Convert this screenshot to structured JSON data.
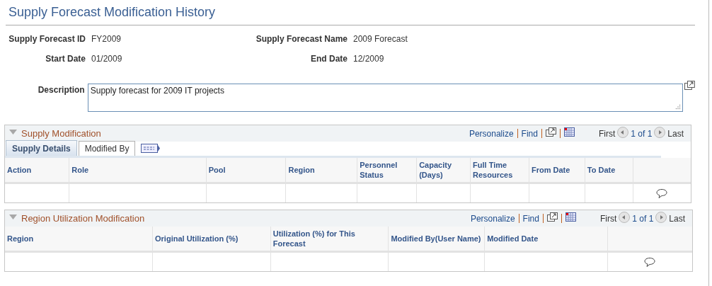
{
  "title": "Supply Forecast Modification History",
  "fields": [
    {
      "label": "Supply Forecast ID",
      "value": "FY2009"
    },
    {
      "label": "Supply Forecast Name",
      "value": "2009 Forecast"
    },
    {
      "label": "Start Date",
      "value": "01/2009"
    },
    {
      "label": "End Date",
      "value": "12/2009"
    }
  ],
  "description": {
    "label": "Description",
    "value": "Supply forecast for 2009 IT projects"
  },
  "grids": [
    {
      "title": "Supply Modification",
      "toolbar": {
        "personalize": "Personalize",
        "find": "Find",
        "first": "First",
        "range": "1 of 1",
        "last": "Last"
      },
      "tabs": [
        {
          "label": "Supply Details",
          "selected": true
        },
        {
          "label": "Modified By",
          "selected": false
        }
      ],
      "columns": [
        "Action",
        "Role",
        "Pool",
        "Region",
        "Personnel Status",
        "Capacity (Days)",
        "Full Time Resources",
        "From Date",
        "To Date"
      ]
    },
    {
      "title": "Region Utilization Modification",
      "toolbar": {
        "personalize": "Personalize",
        "find": "Find",
        "first": "First",
        "range": "1 of 1",
        "last": "Last"
      },
      "columns": [
        "Region",
        "Original Utilization (%)",
        "Utilization (%) for This Forecast",
        "Modified By(User Name)",
        "Modified Date"
      ]
    }
  ]
}
